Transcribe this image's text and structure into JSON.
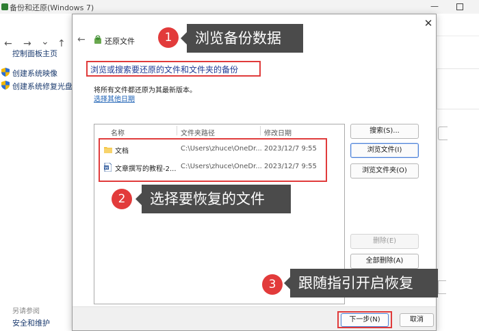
{
  "background_window": {
    "title": "备份和还原(Windows 7)",
    "min_glyph": "—",
    "nav": {
      "back": "←",
      "forward": "→",
      "recent": "⌄",
      "up": "↑"
    },
    "sidebar": {
      "home": "控制面板主页",
      "create_image": "创建系统映像",
      "create_disc": "创建系统修复光盘",
      "see_also": "另请参阅",
      "security": "安全和维护"
    }
  },
  "dialog": {
    "close_glyph": "✕",
    "back_glyph": "←",
    "title": "还原文件",
    "heading": "浏览或搜索要还原的文件和文件夹的备份",
    "info": "将所有文件都还原为其最新版本。",
    "other_date_link": "选择其他日期",
    "columns": {
      "name": "名称",
      "path": "文件夹路径",
      "date": "修改日期"
    },
    "files": [
      {
        "name": "文档",
        "path": "C:\\Users\\zhuce\\OneDr...",
        "date": "2023/12/7 9:55",
        "type": "folder"
      },
      {
        "name": "文章撰写的教程-2...",
        "path": "C:\\Users\\zhuce\\OneDr...",
        "date": "2023/12/7 9:55",
        "type": "word-document"
      }
    ],
    "buttons": {
      "search": "搜索(S)...",
      "browse_files": "浏览文件(I)",
      "browse_folders": "浏览文件夹(O)",
      "remove": "删除(E)",
      "remove_all": "全部删除(A)"
    },
    "footer": {
      "next": "下一步(N)",
      "cancel": "取消"
    }
  },
  "annotations": [
    {
      "step": "1",
      "text": "浏览备份数据"
    },
    {
      "step": "2",
      "text": "选择要恢复的文件"
    },
    {
      "step": "3",
      "text": "跟随指引开启恢复"
    }
  ],
  "colors": {
    "highlight_red": "#e03a3a",
    "badge_red": "#e23b3b",
    "callout_bg": "#4b4b4b",
    "heading_blue": "#1e3a94",
    "link_blue": "#1a5fb4",
    "folder_yellow": "#f4c542",
    "word_blue": "#2b579a"
  }
}
